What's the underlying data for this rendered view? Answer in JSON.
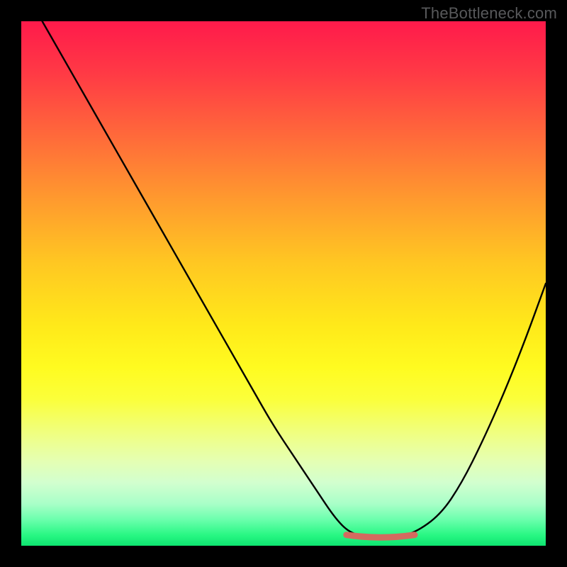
{
  "watermark": "TheBottleneck.com",
  "chart_data": {
    "type": "line",
    "title": "",
    "xlabel": "",
    "ylabel": "",
    "xlim": [
      0,
      100
    ],
    "ylim": [
      0,
      100
    ],
    "grid": false,
    "series": [
      {
        "name": "curve",
        "x": [
          4,
          8,
          12,
          16,
          20,
          24,
          28,
          32,
          36,
          40,
          44,
          48,
          52,
          56,
          60,
          63,
          67,
          71,
          75,
          80,
          84,
          88,
          92,
          96,
          100
        ],
        "values": [
          100,
          93,
          86,
          79,
          72,
          65,
          58,
          51,
          44,
          37,
          30,
          23,
          17,
          11,
          5,
          2.2,
          1.6,
          1.6,
          2.4,
          6,
          12,
          20,
          29,
          39,
          50
        ]
      }
    ],
    "marker": {
      "name": "optimal-range",
      "x_start": 62,
      "x_end": 75,
      "y": 1.8,
      "color": "#d46a5f"
    },
    "background_gradient_stops": [
      {
        "pos": 0,
        "color": "#ff1a4b"
      },
      {
        "pos": 22,
        "color": "#ff6a3a"
      },
      {
        "pos": 46,
        "color": "#ffc722"
      },
      {
        "pos": 66,
        "color": "#fffb20"
      },
      {
        "pos": 88,
        "color": "#d2ffcf"
      },
      {
        "pos": 100,
        "color": "#0ee470"
      }
    ]
  }
}
